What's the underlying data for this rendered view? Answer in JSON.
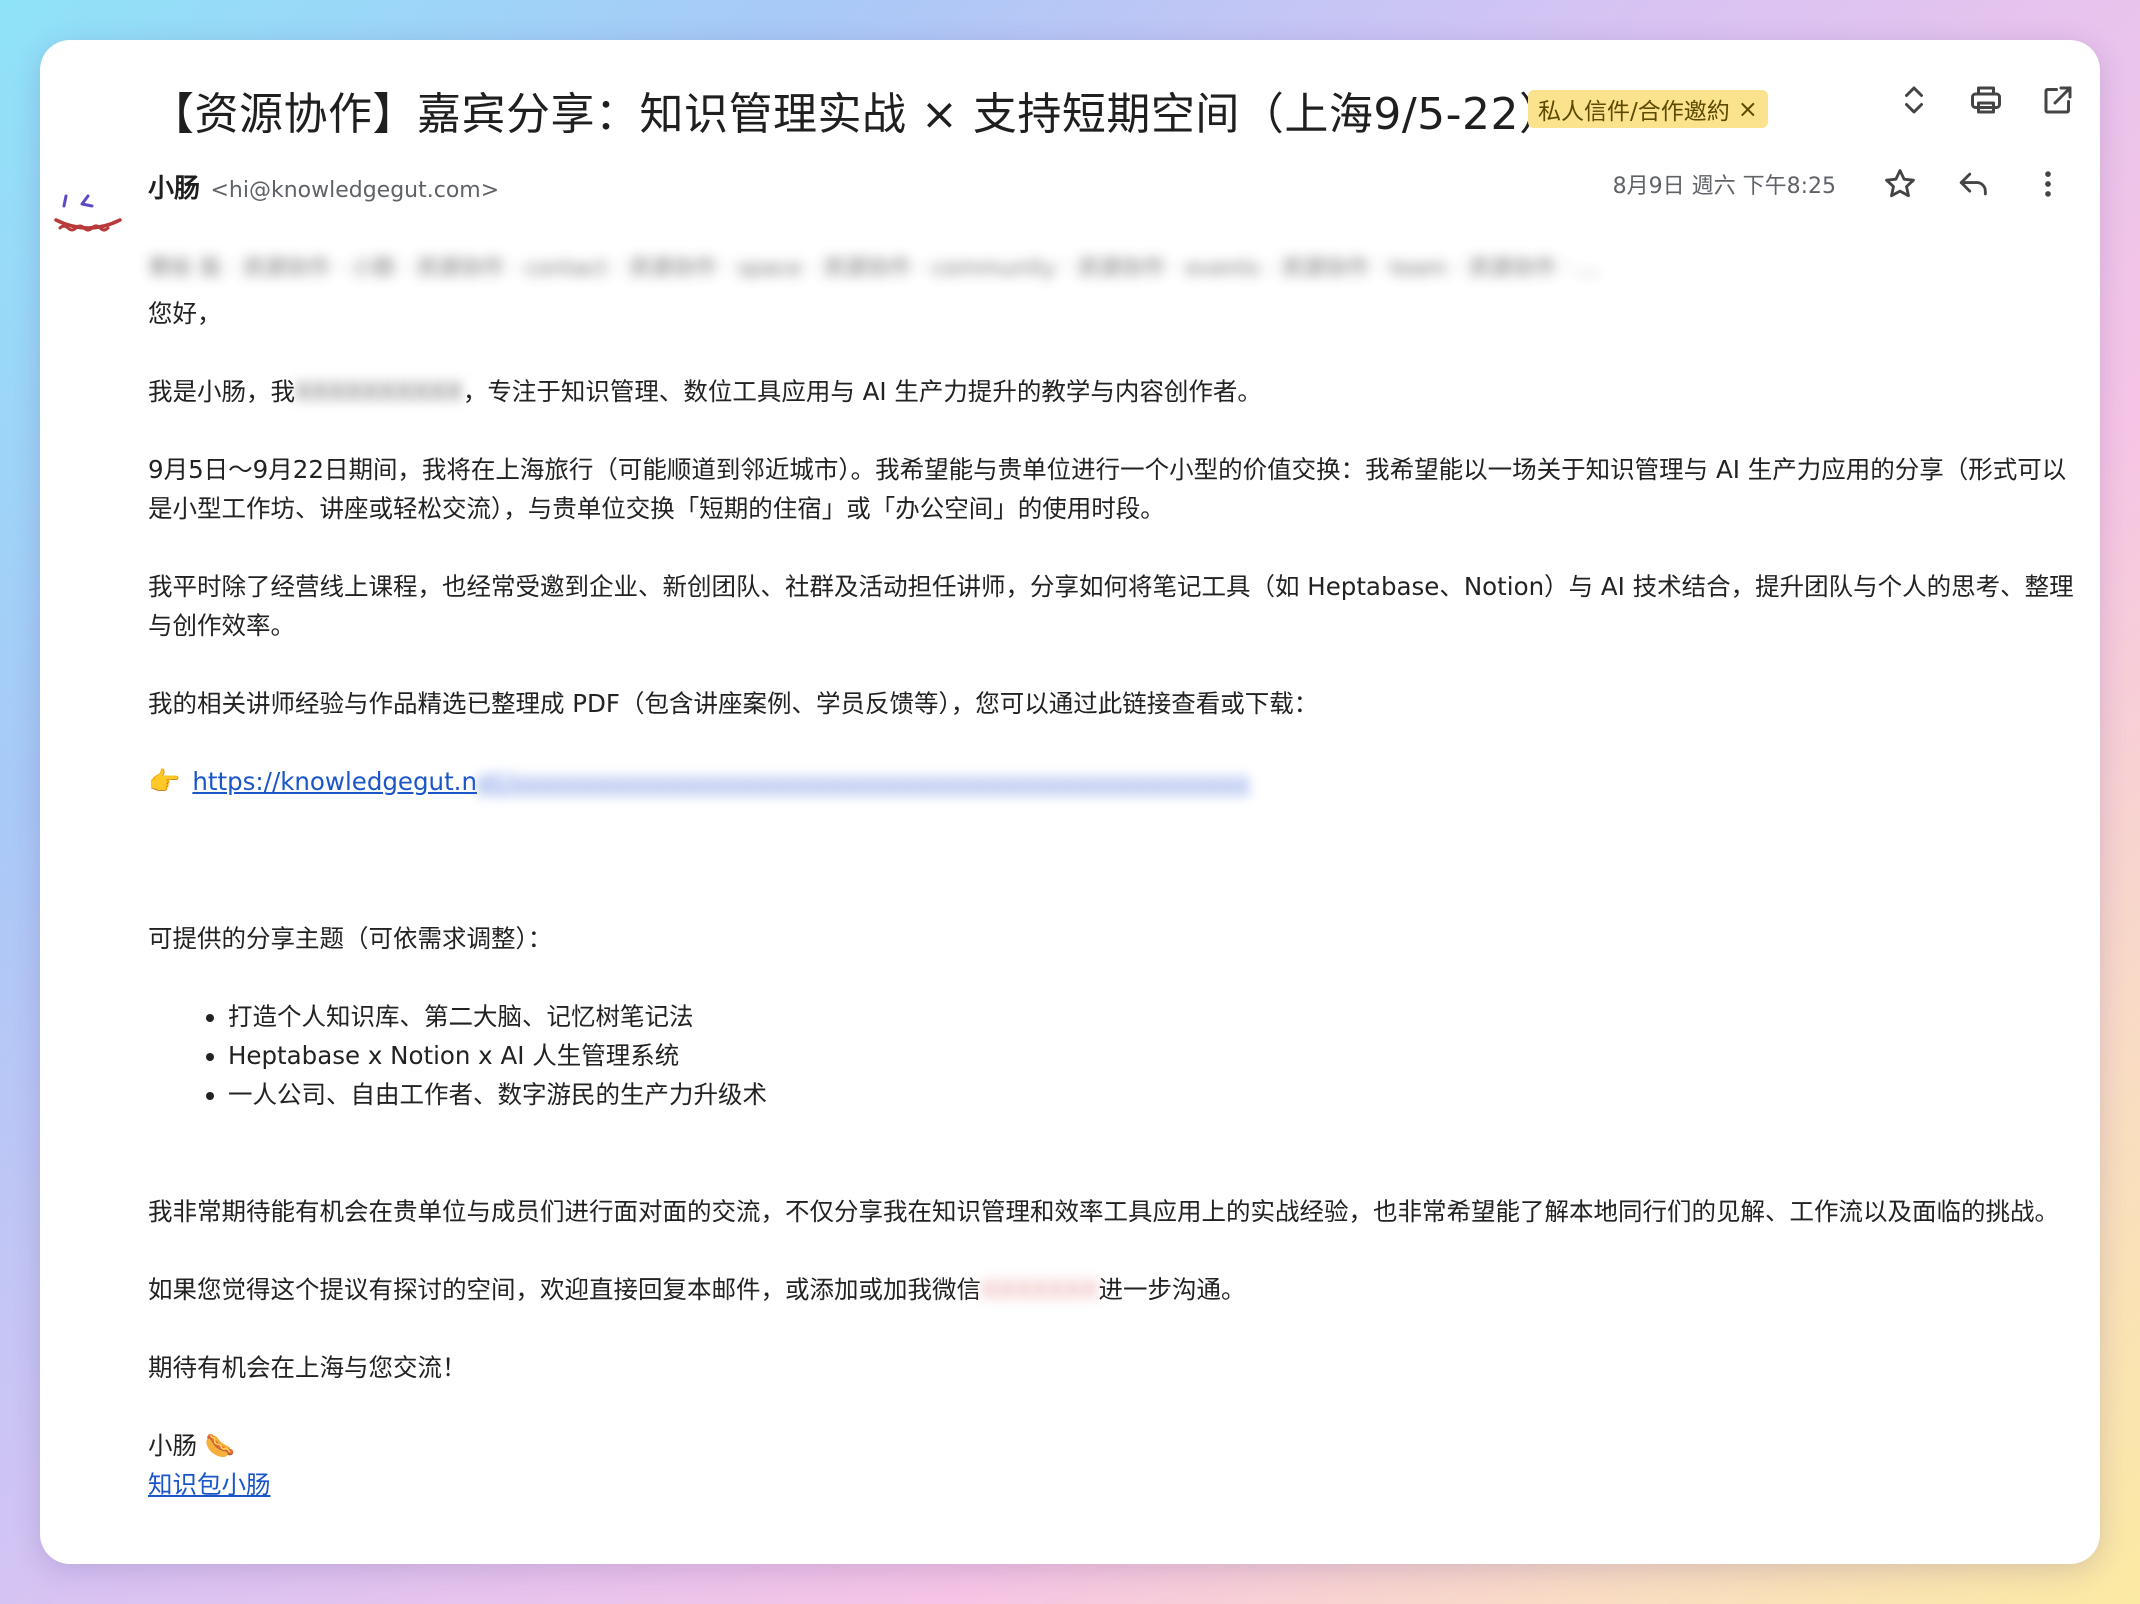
{
  "email": {
    "subject": "【资源协作】嘉宾分享：知识管理实战 × 支持短期空间（上海9/5-22）",
    "label": "私人信件/合作邀約",
    "label_remove": "×",
    "sender": {
      "name": "小肠",
      "email": "<hi@knowledgegut.com>"
    },
    "date": "8月9日 週六 下午8:25",
    "recipients_blurred": "寄给 我 · 资源协作 · 小肠 · 资源协作 · contact · 资源协作 · space · 资源协作 · community · 资源协作 · events · 资源协作 · team · 资源协作 · …",
    "body": {
      "greeting": "您好，",
      "intro_a": "我是小肠，我",
      "intro_blur": "XXXXXXXXXX",
      "intro_b": "，专注于知识管理、数位工具应用与 AI 生产力提升的教学与内容创作者。",
      "para_travel": "9月5日～9月22日期间，我将在上海旅行（可能顺道到邻近城市）。我希望能与贵单位进行一个小型的价值交换：我希望能以一场关于知识管理与 AI 生产力应用的分享（形式可以是小型工作坊、讲座或轻松交流），与贵单位交换「短期的住宿」或「办公空间」的使用时段。",
      "para_teaching": "我平时除了经营线上课程，也经常受邀到企业、新创团队、社群及活动担任讲师，分享如何将笔记工具（如 Heptabase、Notion）与 AI 技术结合，提升团队与个人的思考、整理与创作效率。",
      "para_pdf": "我的相关讲师经验与作品精选已整理成 PDF（包含讲座案例、学员反馈等），您可以通过此链接查看或下载：",
      "link_emoji": "👉",
      "link_visible": "https://knowledgegut.n",
      "link_blur": "et/xxxxxxxxxxxxxxxxxxxxxxxxxxxxxxxxxxxxxxxxxxxxxxxxxxx",
      "topics_heading": "可提供的分享主题（可依需求调整）：",
      "topics": [
        "打造个人知识库、第二大脑、记忆树笔记法",
        "Heptabase x Notion x AI 人生管理系统",
        "一人公司、自由工作者、数字游民的生产力升级术"
      ],
      "para_expect": "我非常期待能有机会在贵单位与成员们进行面对面的交流，不仅分享我在知识管理和效率工具应用上的实战经验，也非常希望能了解本地同行们的见解、工作流以及面临的挑战。",
      "contact_a": "如果您觉得这个提议有探讨的空间，欢迎直接回复本邮件，或添加或加我微信",
      "contact_blur": "XXXXXXX",
      "contact_b": "进一步沟通。",
      "closing": "期待有机会在上海与您交流！",
      "signature_name": "小肠 🌭",
      "signature_link": "知识包小肠"
    }
  },
  "colors": {
    "label_bg": "#fbe38d",
    "link": "#1a56c7",
    "text": "#222222"
  }
}
